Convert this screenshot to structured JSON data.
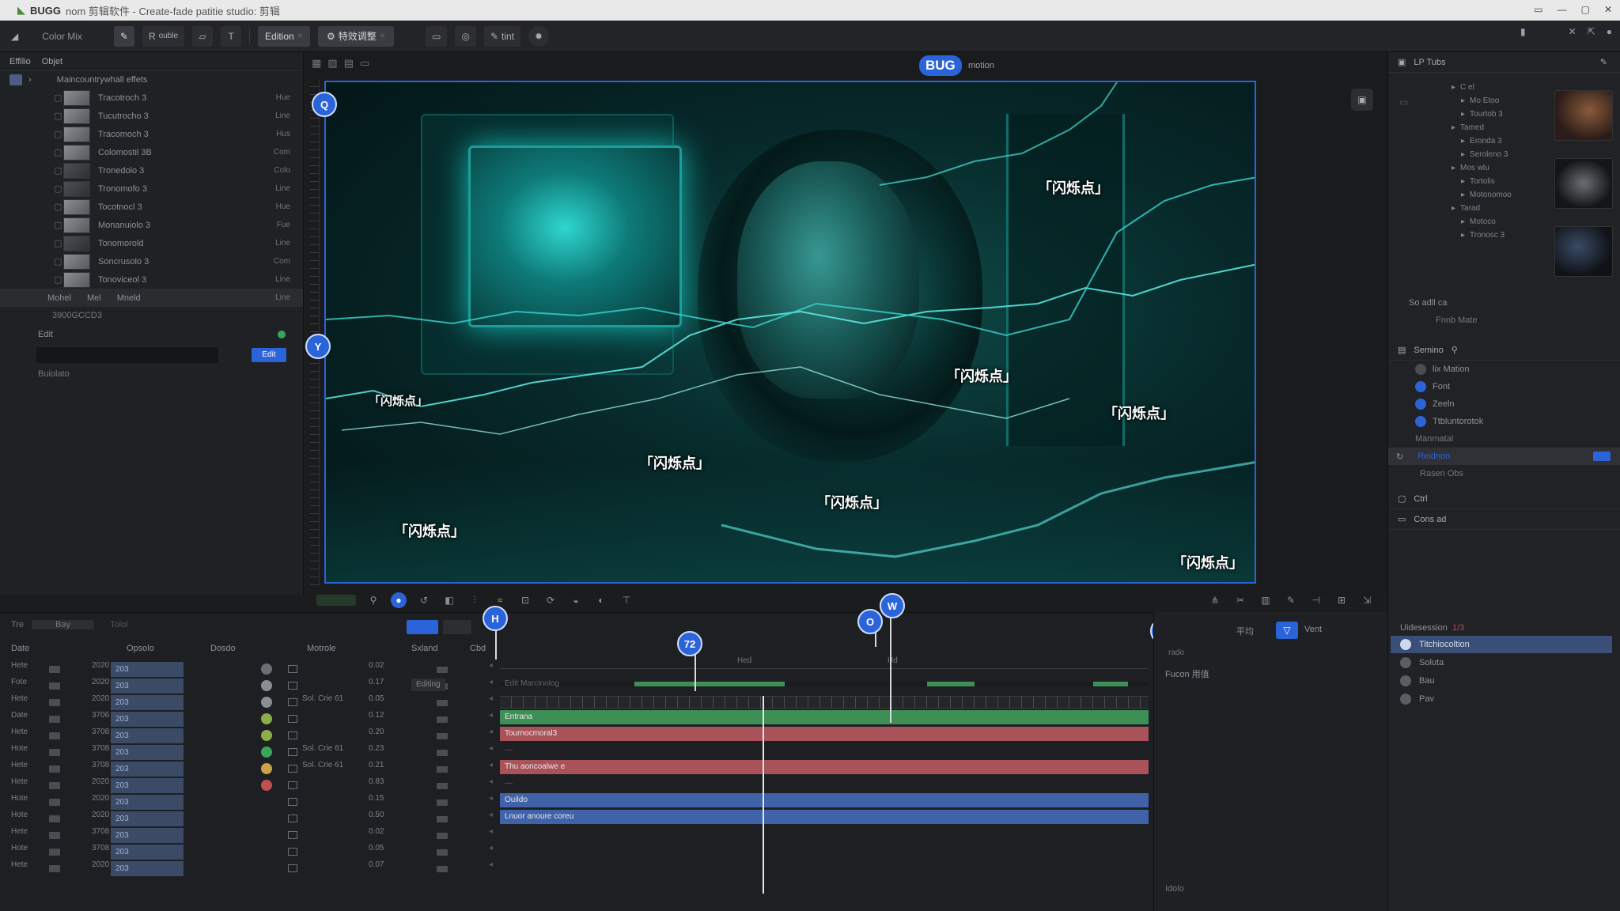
{
  "window": {
    "title_app": "BUGG",
    "title_rest": "nom 剪辑软件 - Create-fade patitie studio: 剪辑",
    "controls": [
      "▭",
      "—",
      "▢",
      "✕"
    ]
  },
  "toolbar": {
    "left_label": "Color Mix",
    "tool_pen": "✎",
    "tool_r": "R",
    "tool_r_label": "ouble",
    "tool_t": "T",
    "tab1": "Edition",
    "tab2": "特效调整",
    "btn_tint": "tint"
  },
  "left_panel": {
    "head1": "Effilio",
    "head2": "Objet",
    "project": "Maincountrywhall effets",
    "layers": [
      {
        "name": "Tracotroch 3",
        "tag": "Hue",
        "thumb": "light"
      },
      {
        "name": "Tucutrocho 3",
        "tag": "Line",
        "thumb": "light"
      },
      {
        "name": "Tracomoch 3",
        "tag": "Hus",
        "thumb": "light"
      },
      {
        "name": "Colomostil 3B",
        "tag": "Com",
        "thumb": "light"
      },
      {
        "name": "Tronedolo 3",
        "tag": "Colo",
        "thumb": "dark"
      },
      {
        "name": "Tronomofo 3",
        "tag": "Line",
        "thumb": "dark"
      },
      {
        "name": "Tocotnocl 3",
        "tag": "Hue",
        "thumb": "light"
      },
      {
        "name": "Monanuiolo 3",
        "tag": "Fue",
        "thumb": "light"
      },
      {
        "name": "Tonomorold",
        "tag": "Line",
        "thumb": "dark"
      },
      {
        "name": "Soncrusolo 3",
        "tag": "Com",
        "thumb": "light"
      },
      {
        "name": "Tonoviceol 3",
        "tag": "Line",
        "thumb": "light"
      }
    ],
    "sel_row": {
      "a": "Mohel",
      "b": "Mel",
      "c": "Mneld",
      "tag": "Line"
    },
    "footer1": "3900GCCD3",
    "footer_pin": "Edit",
    "btn_apply": "Edit",
    "footer2": "Buiolato"
  },
  "viewer": {
    "badge": "BUG",
    "badge_sub": "motion",
    "flickers": [
      "「闪烁点」",
      "「闪烁点」",
      "「闪烁点」",
      "「闪烁点」",
      "「闪烁点」",
      "「闪烁点」",
      "「闪烁点」",
      "「闪烁点」"
    ],
    "pins": [
      "Q",
      "Y",
      "H",
      "72",
      "O",
      "W",
      "V"
    ]
  },
  "right_panel": {
    "head": "LP Tubs",
    "tree": [
      "C el",
      "Mo Etoo",
      "Tourtob 3",
      "Tamed",
      "Eronda 3",
      "Seroleno 3",
      "Mos wlu",
      "Tortolis",
      "Motonomoo",
      "Tarad",
      "Motoco",
      "Tronosc 3"
    ],
    "mid_label": "So adll ca",
    "mid_label2": "Fnnb Mate",
    "props_head": "Semino",
    "props": [
      {
        "label": "lix Mation",
        "dot": "grey"
      },
      {
        "label": "Font",
        "dot": "blue"
      },
      {
        "label": "Zeeln",
        "dot": "blue"
      },
      {
        "label": "Ttbluntorotok",
        "dot": "blue"
      }
    ],
    "prop_extra": "Manmatal",
    "prop_sel": "Reidnon",
    "prop_foot": "Rasen Obs",
    "section2": "Ctrl",
    "section3": "Cons ad"
  },
  "timeline": {
    "tabs": [
      "Tre",
      "Bay",
      "Tolol"
    ],
    "headers": [
      "Date",
      "Opsolo",
      "Dosdo",
      "Motrole",
      "Sxland",
      "Cbd"
    ],
    "ruler_labels": [
      "Hed",
      "Hd"
    ],
    "rows": [
      {
        "id": "Hete",
        "num": "2020",
        "val": "203",
        "c6": "",
        "c7": "0.02"
      },
      {
        "id": "Fote",
        "num": "2020",
        "val": "203",
        "c6": "",
        "c7": "0.17"
      },
      {
        "id": "Hete",
        "num": "2020",
        "val": "203",
        "c6": "Sol. Crie 61",
        "c7": "0.05"
      },
      {
        "id": "Date",
        "num": "3706",
        "val": "203",
        "c6": "",
        "c7": "0.12"
      },
      {
        "id": "Hete",
        "num": "3708",
        "val": "203",
        "c6": "",
        "c7": "0.20"
      },
      {
        "id": "Hote",
        "num": "3708",
        "val": "203",
        "c6": "Sol. Crie 61",
        "c7": "0.23"
      },
      {
        "id": "Hete",
        "num": "3708",
        "val": "203",
        "c6": "Sol. Crie 61",
        "c7": "0.21"
      },
      {
        "id": "Hete",
        "num": "2020",
        "val": "203",
        "c6": "",
        "c7": "0.83"
      },
      {
        "id": "Hote",
        "num": "2020",
        "val": "203",
        "c6": "",
        "c7": "0.15"
      },
      {
        "id": "Hote",
        "num": "2020",
        "val": "203",
        "c6": "",
        "c7": "0.50"
      },
      {
        "id": "Hete",
        "num": "3708",
        "val": "203",
        "c6": "",
        "c7": "0.02"
      },
      {
        "id": "Hote",
        "num": "3708",
        "val": "203",
        "c6": "",
        "c7": "0.05"
      },
      {
        "id": "Hete",
        "num": "2020",
        "val": "203",
        "c6": "",
        "c7": "0.07"
      }
    ],
    "tracks": [
      {
        "label": "Edit Marcinolog",
        "kind": "empty"
      },
      {
        "label": "Entrana",
        "kind": "green"
      },
      {
        "label": "Tournocmoral3",
        "kind": "red"
      },
      {
        "label": "—",
        "kind": "empty"
      },
      {
        "label": "Thu aoncoalwe e",
        "kind": "red"
      },
      {
        "label": "—",
        "kind": "empty"
      },
      {
        "label": "Ouildo",
        "kind": "blue"
      },
      {
        "label": "Lnuor anoure coreu",
        "kind": "blue"
      }
    ],
    "side_tag": "Editing",
    "right_panel": {
      "top1": "平均",
      "top2": "Vent",
      "label1": "Fucon 用值",
      "label2": "rado",
      "list_head": "Uidesession",
      "list_head2": "1/3",
      "items": [
        {
          "label": "Titchiocoltion",
          "sel": true
        },
        {
          "label": "Soluta",
          "sel": false
        },
        {
          "label": "Bau",
          "sel": false
        },
        {
          "label": "Pav",
          "sel": false
        }
      ],
      "bottom": "Idolo"
    }
  },
  "colors": {
    "accent": "#2b63d9",
    "track_green": "#3e8f56",
    "track_red": "#a9525a",
    "track_blue": "#3f62a8",
    "viewer_teal": "#14b8b1"
  }
}
